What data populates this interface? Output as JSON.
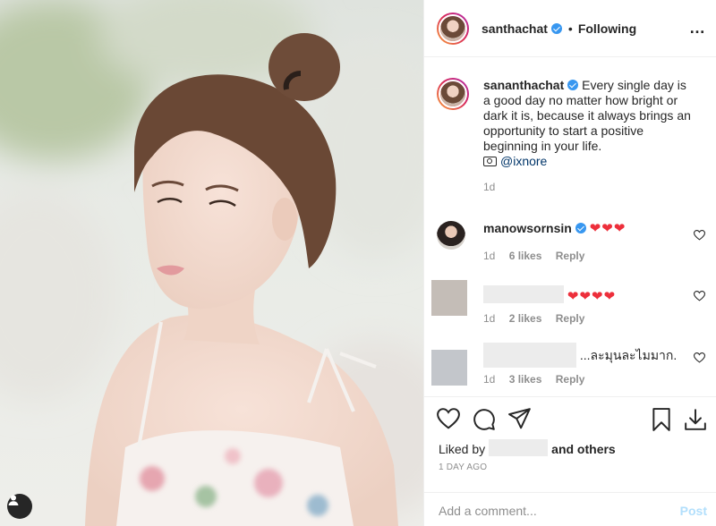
{
  "post": {
    "author": "santhachat",
    "follow_status": "Following",
    "separator": "•",
    "more_icon": "…"
  },
  "caption": {
    "username": "sananthachat",
    "text": "Every single day is a good day no matter how bright or dark it is, because it always brings an opportunity to start a positive beginning in your life.",
    "photo_credit": "@ixnore",
    "time": "1d"
  },
  "comments": [
    {
      "username": "manowsornsin",
      "text": "❤❤❤",
      "time": "1d",
      "likes": "6 likes",
      "reply": "Reply"
    },
    {
      "username": "",
      "text": "❤❤❤❤",
      "time": "1d",
      "likes": "2 likes",
      "reply": "Reply"
    },
    {
      "username": "",
      "text": "...ละมุนละไมมาก.",
      "time": "1d",
      "likes": "3 likes",
      "reply": "Reply"
    }
  ],
  "actions": {
    "liked_by_prefix": "Liked by",
    "liked_by_suffix": "and others",
    "timestamp": "1 DAY AGO",
    "add_comment_placeholder": "Add a comment...",
    "post_label": "Post"
  },
  "colors": {
    "verified": "#3897f0",
    "heart": "#ed2f3b",
    "post_disabled": "#b2dffc",
    "link": "#003569"
  },
  "icons": [
    "heart-icon",
    "comment-icon",
    "share-icon",
    "bookmark-icon",
    "download-icon",
    "user-tag-icon",
    "verified-badge-icon",
    "camera-icon",
    "more-options-icon"
  ]
}
